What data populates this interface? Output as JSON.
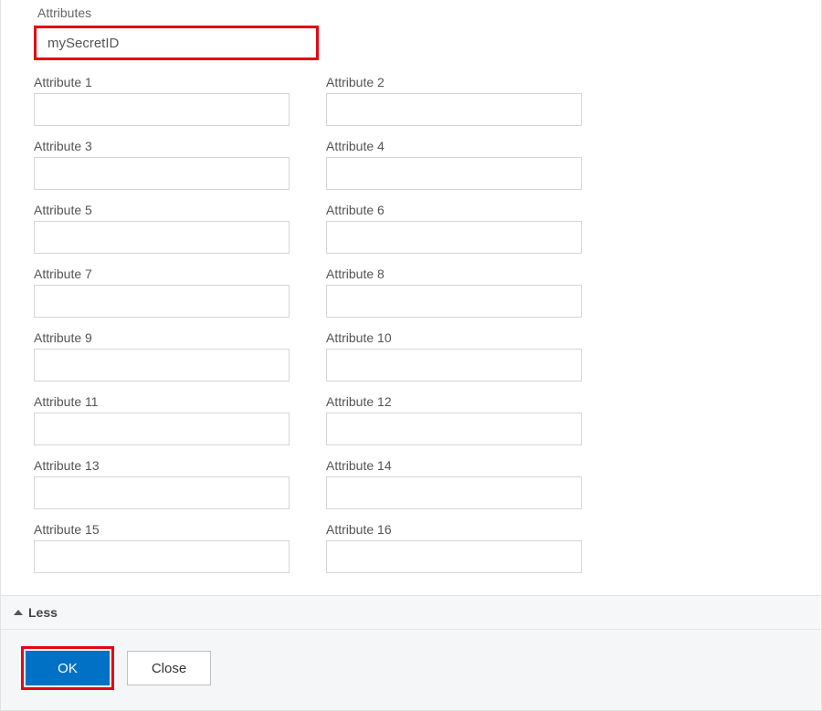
{
  "section": {
    "title": "Attributes",
    "primary_value": "mySecretID"
  },
  "attributes": [
    {
      "label": "Attribute 1",
      "value": ""
    },
    {
      "label": "Attribute 2",
      "value": ""
    },
    {
      "label": "Attribute 3",
      "value": ""
    },
    {
      "label": "Attribute 4",
      "value": ""
    },
    {
      "label": "Attribute 5",
      "value": ""
    },
    {
      "label": "Attribute 6",
      "value": ""
    },
    {
      "label": "Attribute 7",
      "value": ""
    },
    {
      "label": "Attribute 8",
      "value": ""
    },
    {
      "label": "Attribute 9",
      "value": ""
    },
    {
      "label": "Attribute 10",
      "value": ""
    },
    {
      "label": "Attribute 11",
      "value": ""
    },
    {
      "label": "Attribute 12",
      "value": ""
    },
    {
      "label": "Attribute 13",
      "value": ""
    },
    {
      "label": "Attribute 14",
      "value": ""
    },
    {
      "label": "Attribute 15",
      "value": ""
    },
    {
      "label": "Attribute 16",
      "value": ""
    }
  ],
  "toggle": {
    "label": "Less"
  },
  "buttons": {
    "ok": "OK",
    "close": "Close"
  },
  "colors": {
    "highlight": "#e30613",
    "primary": "#0071c5"
  }
}
